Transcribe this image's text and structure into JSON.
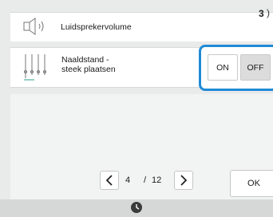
{
  "settings": {
    "volume": {
      "label": "Luidsprekervolume",
      "icon": "speaker-icon",
      "value": "3",
      "more_indicator": ")"
    },
    "needle_position": {
      "label": "Naaldstand -\nsteek plaatsen",
      "icon": "needle-position-icon",
      "on_label": "ON",
      "off_label": "OFF",
      "selected": "OFF"
    }
  },
  "pagination": {
    "current": "4",
    "separator": "/",
    "total": "12",
    "prev_icon": "chevron-left-icon",
    "next_icon": "chevron-right-icon"
  },
  "ok_label": "OK",
  "bottom_icon": "clock-icon",
  "colors": {
    "highlight": "#1f8bd6",
    "background": "#e9eaea",
    "off_selected": "#dcdcdc"
  }
}
